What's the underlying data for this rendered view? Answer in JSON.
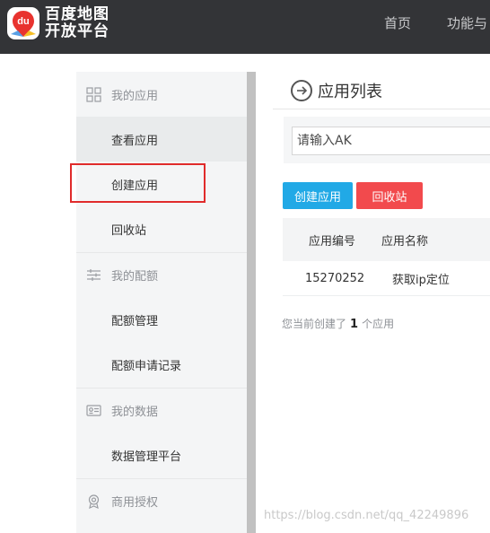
{
  "header": {
    "logo_line1": "百度地图",
    "logo_line2": "开放平台",
    "logo_mark_text": "du",
    "nav": [
      "首页",
      "功能与"
    ]
  },
  "sidebar": {
    "groups": [
      {
        "title": "我的应用",
        "icon": "grid-icon",
        "items": [
          "查看应用",
          "创建应用",
          "回收站"
        ]
      },
      {
        "title": "我的配额",
        "icon": "sliders-icon",
        "items": [
          "配额管理",
          "配额申请记录"
        ]
      },
      {
        "title": "我的数据",
        "icon": "id-card-icon",
        "items": [
          "数据管理平台"
        ]
      },
      {
        "title": "商用授权",
        "icon": "award-icon",
        "items": []
      }
    ],
    "active_item": "查看应用",
    "highlighted_item": "创建应用"
  },
  "main": {
    "title": "应用列表",
    "ak_placeholder": "请输入AK",
    "create_button": "创建应用",
    "recycle_button": "回收站",
    "table": {
      "columns": [
        "应用编号",
        "应用名称"
      ],
      "rows": [
        [
          "15270252",
          "获取ip定位"
        ]
      ]
    },
    "count_prefix": "您当前创建了",
    "count_value": "1",
    "count_suffix": "个应用"
  },
  "watermark": "https://blog.csdn.net/qq_42249896",
  "colors": {
    "topbar": "#333437",
    "create_button": "#21a9e6",
    "recycle_button": "#f24a4d",
    "highlight_box": "#e02b2b"
  }
}
